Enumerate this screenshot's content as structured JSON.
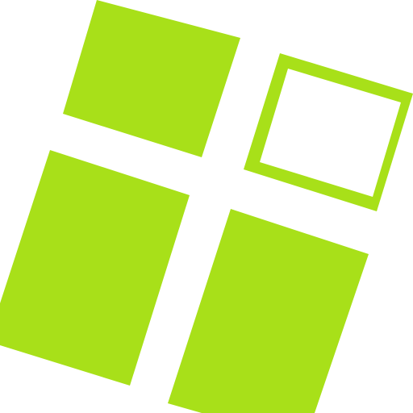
{
  "icon": {
    "name": "dashboard-tiles-icon",
    "color": "#a8e019",
    "background": "#ffffff",
    "tiles": [
      {
        "name": "tile-top-left",
        "style": "filled"
      },
      {
        "name": "tile-top-right",
        "style": "outlined"
      },
      {
        "name": "tile-bottom-left",
        "style": "filled"
      },
      {
        "name": "tile-bottom-right",
        "style": "filled"
      }
    ]
  }
}
